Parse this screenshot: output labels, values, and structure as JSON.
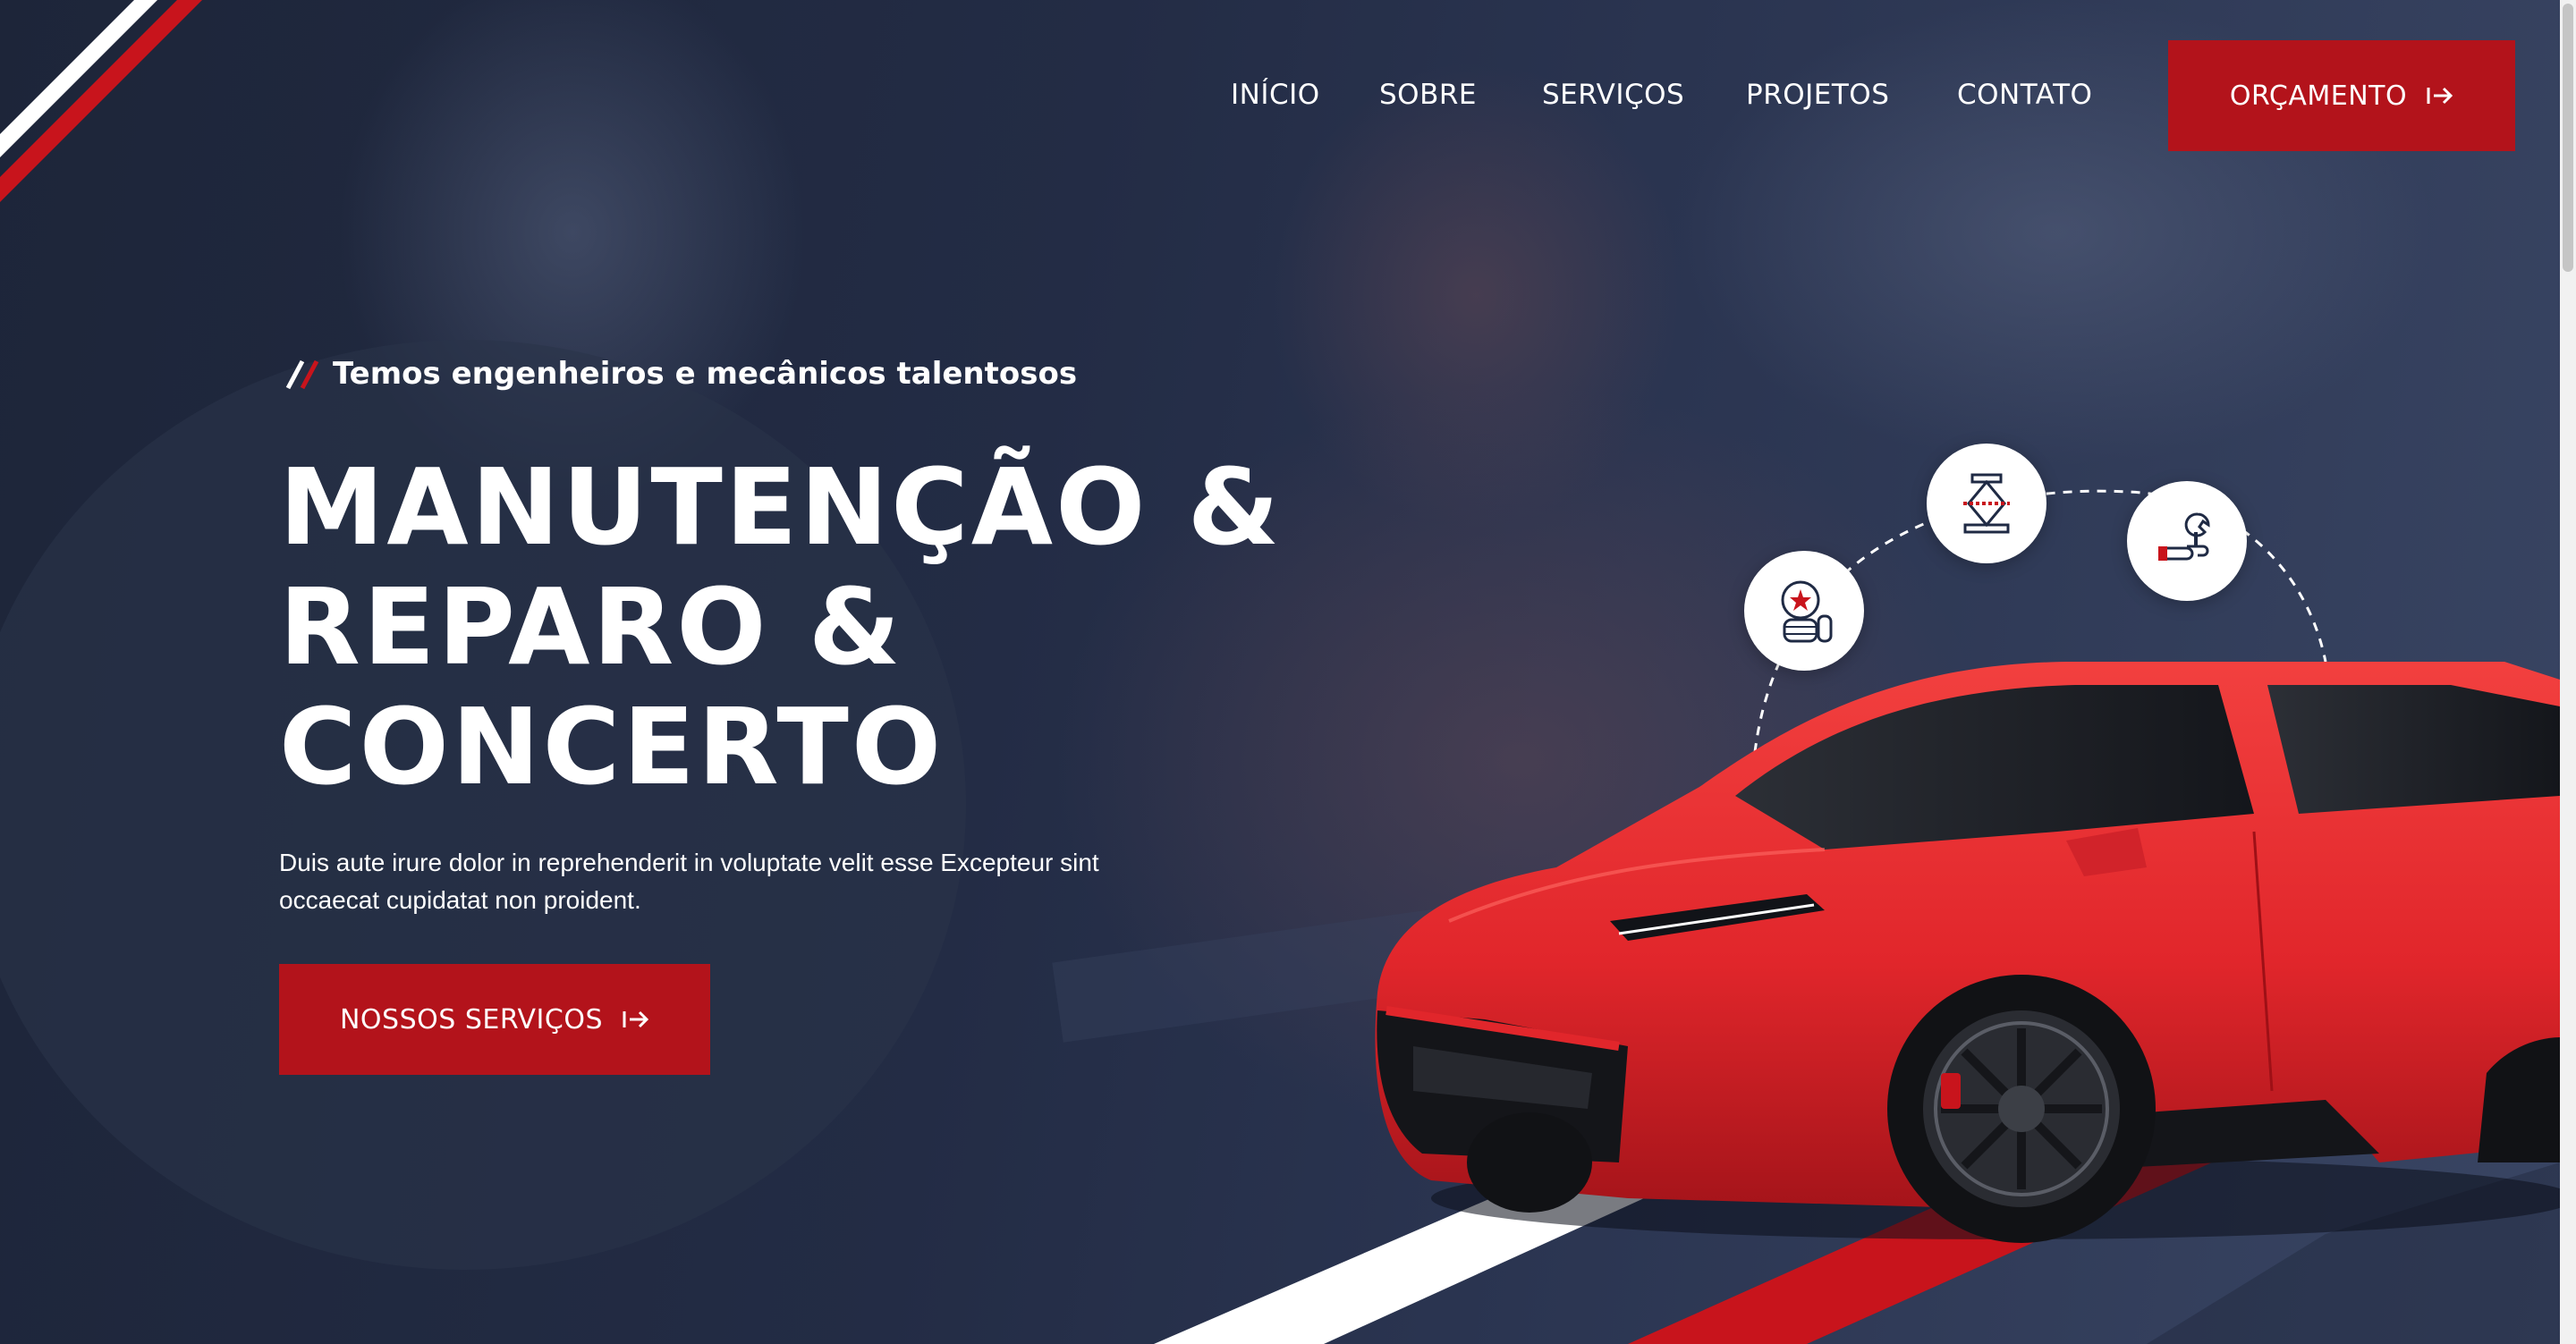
{
  "nav": {
    "items": [
      {
        "label": "INÍCIO"
      },
      {
        "label": "SOBRE"
      },
      {
        "label": "SERVIÇOS"
      },
      {
        "label": "PROJETOS"
      },
      {
        "label": "CONTATO"
      }
    ],
    "cta_label": "ORÇAMENTO"
  },
  "hero": {
    "tagline": "Temos engenheiros e mecânicos talentosos",
    "title_lines": [
      "MANUTENÇÃO &",
      "REPARO &",
      "CONCERTO"
    ],
    "description": "Duis aute irure dolor in reprehenderit in voluptate velit esse Excepteur sint occaecat cupidatat non proident.",
    "cta_label": "NOSSOS SERVIÇOS"
  },
  "icons": {
    "service_1": "tire-star-icon",
    "service_2": "car-jack-icon",
    "service_3": "wrench-hand-icon",
    "arrow": "arrow-right-icon"
  },
  "colors": {
    "accent": "#b3131b",
    "background": "#232c45",
    "car": "#e3262b",
    "text": "#ffffff"
  }
}
